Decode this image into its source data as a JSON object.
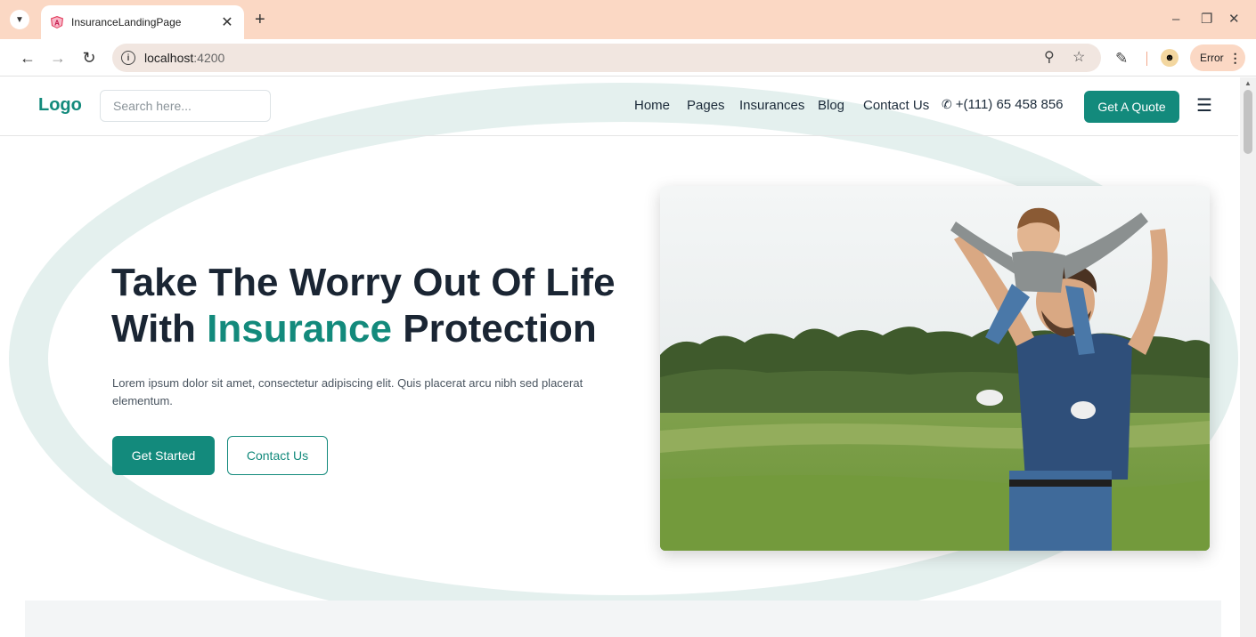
{
  "browser": {
    "tab_title": "InsuranceLandingPage",
    "url_host": "localhost",
    "url_port": ":4200",
    "error_label": "Error"
  },
  "site": {
    "logo": "Logo",
    "search_placeholder": "Search here...",
    "nav": [
      "Home",
      "Pages",
      "Insurances",
      "Blog",
      "Contact Us"
    ],
    "phone": "+(111) 65 458 856",
    "quote_button": "Get A Quote"
  },
  "hero": {
    "title_line1": "Take The Worry Out Of Life",
    "title_line2_prefix": "With ",
    "title_line2_accent": "Insurance",
    "title_line2_suffix": " Protection",
    "description": "Lorem ipsum dolor sit amet, consectetur adipiscing elit. Quis placerat arcu nibh sed placerat elementum.",
    "primary_button": "Get Started",
    "secondary_button": "Contact Us"
  },
  "colors": {
    "accent": "#138a7c",
    "tab_bar": "#fbd8c4",
    "background_ring": "#e4f0ee",
    "heading": "#1a2533"
  },
  "icons": {
    "tab_menu": "chevron-down-icon",
    "favicon": "angular-icon",
    "back": "back-arrow-icon",
    "forward": "forward-arrow-icon",
    "reload": "reload-icon",
    "site_info": "info-icon",
    "zoom": "zoom-icon",
    "bookmark": "star-icon",
    "extensions": "puzzle-icon",
    "phone": "phone-icon",
    "menu": "hamburger-icon"
  }
}
